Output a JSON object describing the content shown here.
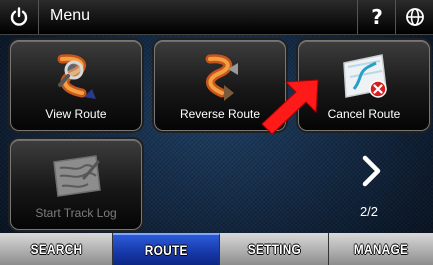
{
  "topbar": {
    "menu_label": "Menu",
    "help_label": "?",
    "icons": {
      "power": "power-icon",
      "globe": "globe-icon"
    }
  },
  "tiles": {
    "view_route": {
      "label": "View Route",
      "icon": "view-route-icon"
    },
    "reverse_route": {
      "label": "Reverse Route",
      "icon": "reverse-route-icon"
    },
    "cancel_route": {
      "label": "Cancel Route",
      "icon": "cancel-route-icon"
    },
    "start_track_log": {
      "label": "Start Track Log",
      "icon": "track-log-icon",
      "enabled": false
    }
  },
  "pager": {
    "indicator": "2/2",
    "next_icon": "chevron-right-icon"
  },
  "tabs": [
    {
      "label": "SEARCH",
      "active": false
    },
    {
      "label": "ROUTE",
      "active": true
    },
    {
      "label": "SETTING",
      "active": false
    },
    {
      "label": "MANAGE",
      "active": false
    }
  ],
  "colors": {
    "active_tab": "#1637a8",
    "highlight_arrow": "#ff1a1a",
    "background": "#152c48"
  }
}
